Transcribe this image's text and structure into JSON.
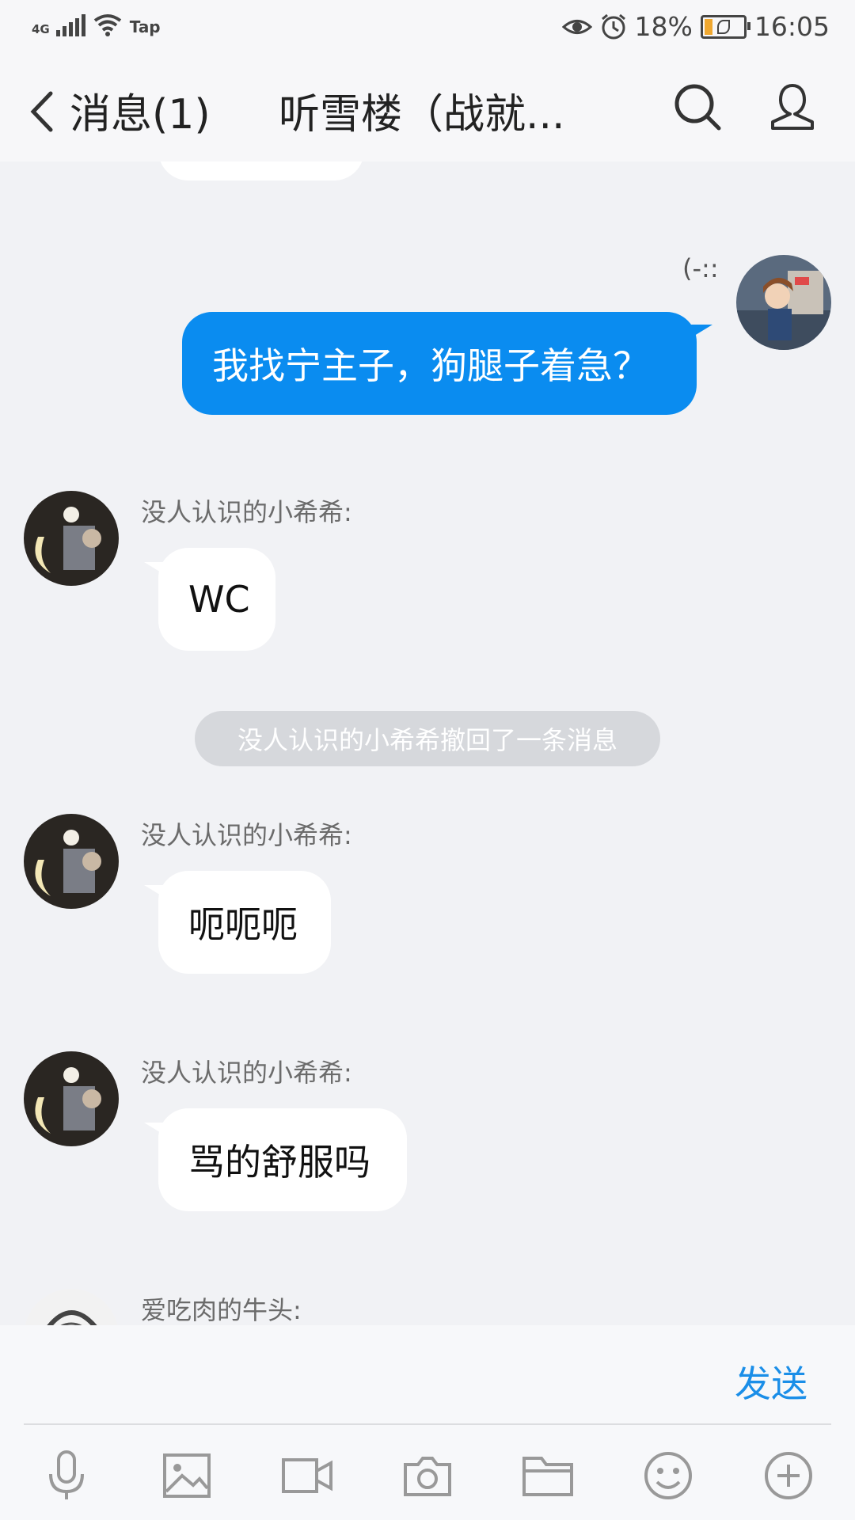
{
  "status_bar": {
    "network": "4G",
    "carrier": "Tap",
    "battery": "18%",
    "time": "16:05"
  },
  "header": {
    "back_label": "消息(1)",
    "title": "听雪楼（战就..."
  },
  "messages": [
    {
      "sender": "",
      "text": "我找宁主子，狗腿子着急？",
      "tag": "(-::",
      "direction": "out"
    },
    {
      "sender": "没人认识的小希希:",
      "text": "WC",
      "direction": "in"
    },
    {
      "system": "没人认识的小希希撤回了一条消息"
    },
    {
      "sender": "没人认识的小希希:",
      "text": "呃呃呃",
      "direction": "in"
    },
    {
      "sender": "没人认识的小希希:",
      "text": "骂的舒服吗",
      "direction": "in"
    },
    {
      "sender": "爱吃肉的牛头:",
      "text": "",
      "direction": "in"
    }
  ],
  "composer": {
    "input_value": "",
    "send_label": "发送"
  },
  "toolbar": [
    "mic-icon",
    "image-icon",
    "video-icon",
    "camera-icon",
    "folder-icon",
    "emoji-icon",
    "plus-icon"
  ],
  "colors": {
    "outgoing_bubble": "#0a8cf0",
    "incoming_bubble": "#ffffff",
    "accent": "#1a8ee8",
    "background": "#f1f2f5"
  }
}
